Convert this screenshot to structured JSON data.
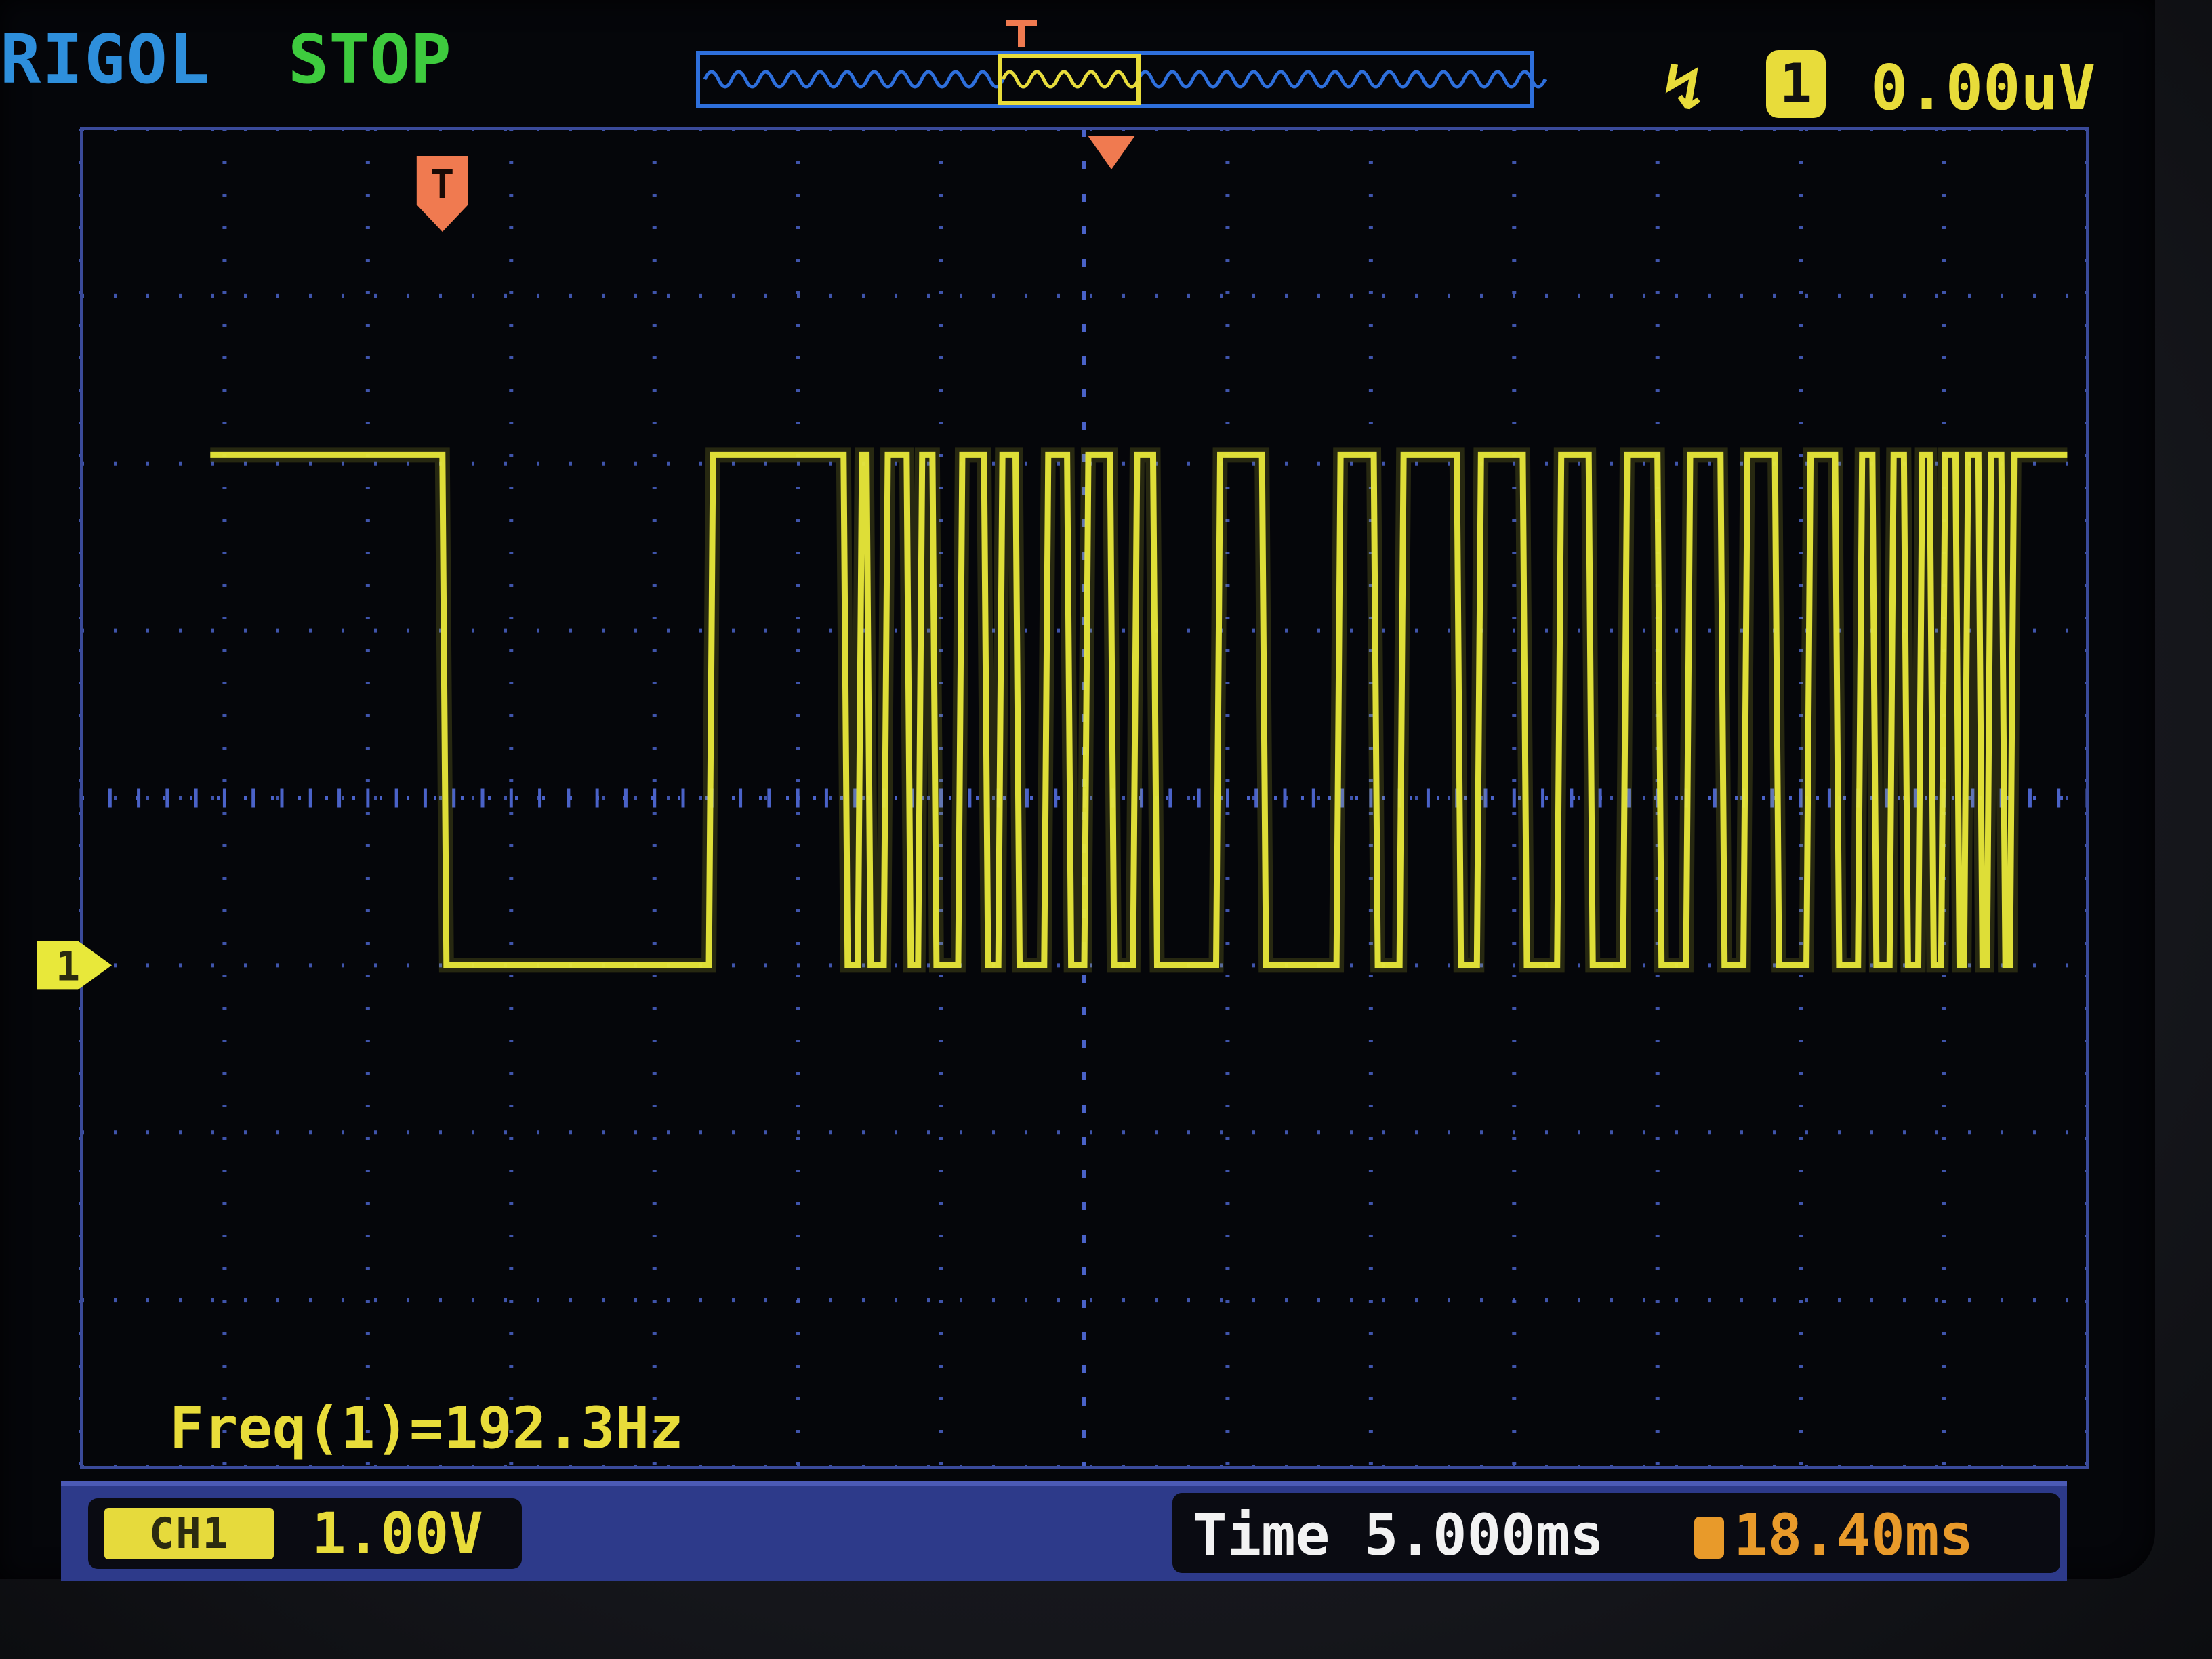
{
  "header": {
    "brand": "RIGOL",
    "run_status": "STOP",
    "trigger_type_icon": "rising-edge-trigger-icon",
    "trigger_channel": "1",
    "trigger_level": "0.00uV"
  },
  "markers": {
    "trigger_marker_label": "T",
    "channel_marker_label": "1"
  },
  "measurement": {
    "text": "Freq(1)=192.3Hz"
  },
  "footer": {
    "channel_tag": "CH1",
    "channel_scale": "1.00V",
    "timebase": "Time 5.000ms",
    "trigger_position": "18.40ms"
  },
  "colors": {
    "trace": "#e8e83a",
    "grid": "#4a62c8",
    "brand": "#2e8fdc",
    "status": "#3ecb3e",
    "trigger_marker": "#f07a50",
    "bottom_bar": "#2d3a8a"
  },
  "chart_data": {
    "type": "line",
    "title": "",
    "xlabel": "",
    "ylabel": "",
    "x_unit": "ms",
    "y_unit": "V",
    "xlim": [
      -35,
      35
    ],
    "ylim": [
      -3,
      5
    ],
    "grid": true,
    "divisions": {
      "x": 14,
      "y": 8
    },
    "volts_per_div": 1.0,
    "ms_per_div": 5.0,
    "series": [
      {
        "name": "1",
        "high": 3.05,
        "low": 0.0,
        "edges_ms": [
          -22.4,
          -13.1,
          -8.4,
          -7.9,
          -7.6,
          -7.0,
          -6.2,
          -5.8,
          -5.3,
          -4.4,
          -3.5,
          -3.0,
          -2.4,
          -1.4,
          -0.6,
          0.0,
          0.9,
          1.7,
          2.4,
          4.6,
          6.2,
          8.8,
          10.1,
          11.0,
          13.0,
          13.7,
          15.3,
          16.5,
          17.6,
          18.8,
          20.0,
          21.0,
          22.2,
          23.0,
          24.1,
          25.2,
          26.2,
          27.0,
          27.5,
          28.1,
          28.6,
          29.1,
          29.5,
          29.9,
          30.4,
          30.7,
          31.2,
          31.5,
          32.0,
          32.3
        ]
      }
    ],
    "annotations": [
      "Freq(1)=192.3Hz"
    ]
  }
}
